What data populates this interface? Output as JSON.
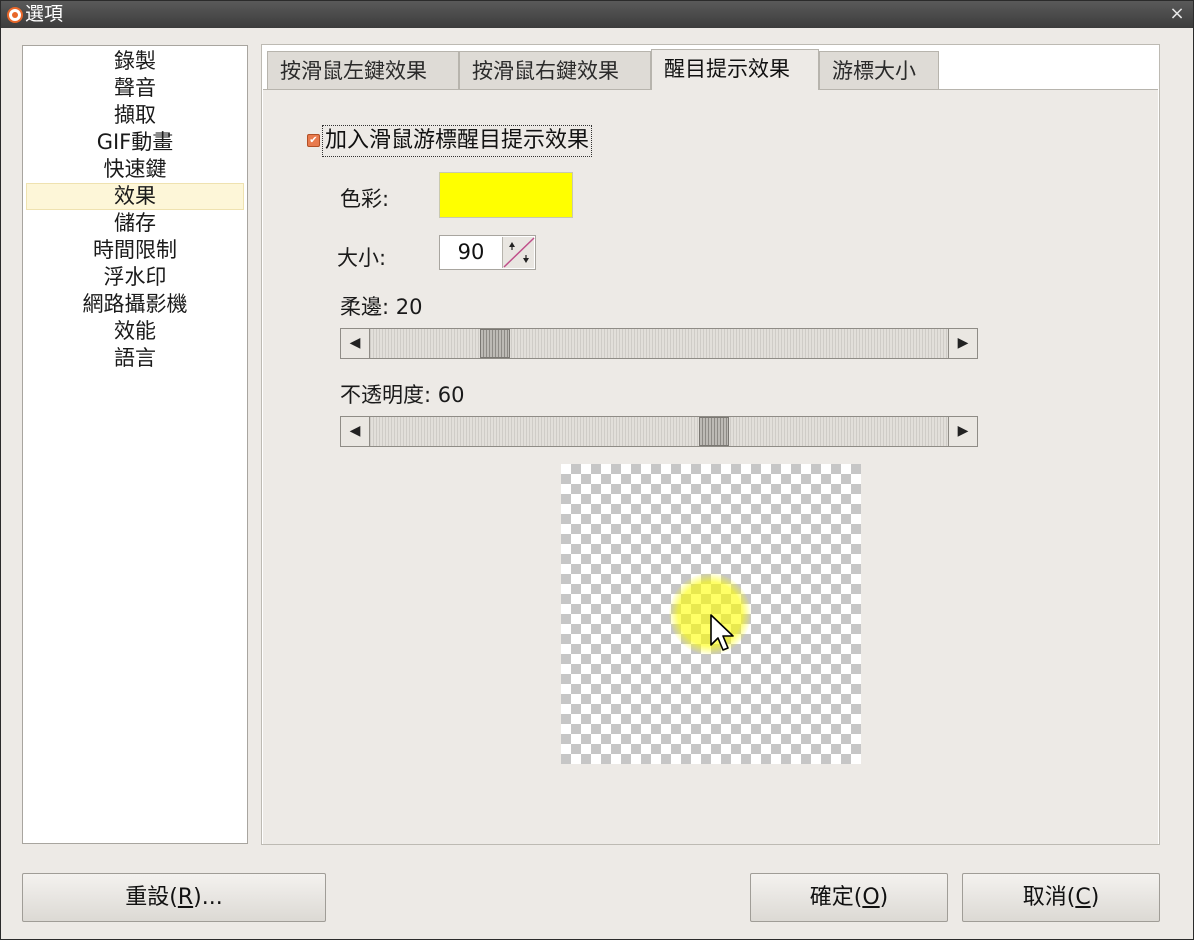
{
  "window": {
    "title": "選項",
    "close_glyph": "×"
  },
  "sidebar": {
    "selected_index": 5,
    "items": [
      {
        "label": "錄製"
      },
      {
        "label": "聲音"
      },
      {
        "label": "擷取"
      },
      {
        "label": "GIF動畫"
      },
      {
        "label": "快速鍵"
      },
      {
        "label": "效果"
      },
      {
        "label": "儲存"
      },
      {
        "label": "時間限制"
      },
      {
        "label": "浮水印"
      },
      {
        "label": "網路攝影機"
      },
      {
        "label": "效能"
      },
      {
        "label": "語言"
      }
    ]
  },
  "tabs": [
    {
      "label": "按滑鼠左鍵效果",
      "active": false
    },
    {
      "label": "按滑鼠右鍵效果",
      "active": false
    },
    {
      "label": "醒目提示效果",
      "active": true
    },
    {
      "label": "游標大小",
      "active": false
    }
  ],
  "highlight": {
    "enable_label": "加入滑鼠游標醒目提示效果",
    "enabled": true,
    "color_label": "色彩:",
    "color_value": "#ffff00",
    "size_label": "大小:",
    "size_value": "90",
    "softness_label": "柔邊: 20",
    "softness_value": 20,
    "opacity_label": "不透明度: 60",
    "opacity_value": 60,
    "slider_min": 0,
    "slider_max": 100
  },
  "buttons": {
    "reset": {
      "text": "重設(",
      "mnemonic": "R",
      "suffix": ")..."
    },
    "ok": {
      "text": "確定(",
      "mnemonic": "O",
      "suffix": ")"
    },
    "cancel": {
      "text": "取消(",
      "mnemonic": "C",
      "suffix": ")"
    }
  },
  "icons": {
    "app": "recorder-app-icon",
    "slider_left": "triangle-left-icon",
    "slider_right": "triangle-right-icon",
    "spin": "spin-arrows-icon",
    "check": "checkmark-icon",
    "cursor": "mouse-pointer-icon"
  }
}
